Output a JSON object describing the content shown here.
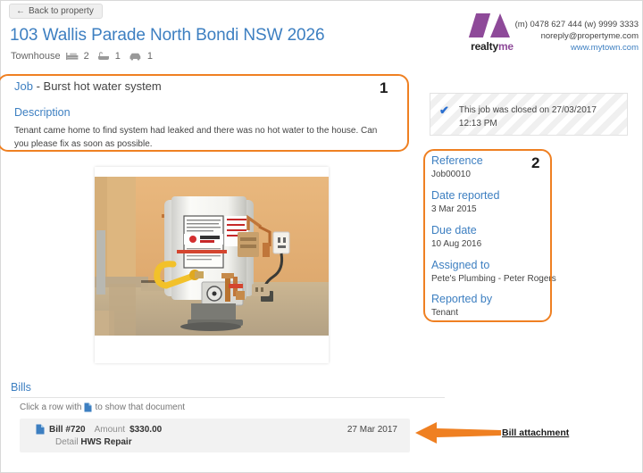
{
  "nav": {
    "back_label": "Back to property",
    "back_icon": "arrow-left-icon"
  },
  "header": {
    "address": "103 Wallis Parade North Bondi NSW 2026",
    "property_type": "Townhouse",
    "features": [
      {
        "icon": "bed-icon",
        "count": "2"
      },
      {
        "icon": "bath-icon",
        "count": "1"
      },
      {
        "icon": "car-icon",
        "count": "1"
      }
    ]
  },
  "brand": {
    "logo_icon": "realtyme-logo-icon",
    "name_first": "realty",
    "name_second": "me",
    "accent_color": "#8e4a99",
    "contact_phone": "(m) 0478 627 444 (w) 9999 3333",
    "contact_email": "noreply@propertyme.com",
    "contact_website": "www.mytown.com"
  },
  "job": {
    "label": "Job",
    "separator": " - ",
    "title": "Burst hot water system",
    "description_heading": "Description",
    "description_body": "Tenant came home to find system had leaked and there was no hot water to the house. Can you please fix as soon as possible.",
    "photo_icon": "hot-water-system-photo"
  },
  "status": {
    "check_icon": "checkmark-icon",
    "message": "This job was closed on 27/03/2017 12:13 PM"
  },
  "details": {
    "fields": [
      {
        "label": "Reference",
        "value": "Job00010"
      },
      {
        "label": "Date reported",
        "value": "3 Mar 2015"
      },
      {
        "label": "Due date",
        "value": "10 Aug 2016"
      },
      {
        "label": "Assigned to",
        "value": "Pete's Plumbing - Peter Rogers"
      },
      {
        "label": "Reported by",
        "value": "Tenant"
      }
    ]
  },
  "bills": {
    "heading": "Bills",
    "hint_before": "Click a row with",
    "hint_icon": "document-icon",
    "hint_after": "to show that document",
    "rows": [
      {
        "doc_icon": "document-icon",
        "number": "Bill #720",
        "amount_label": "Amount",
        "amount": "$330.00",
        "detail_label": "Detail",
        "detail": "HWS Repair",
        "date": "27 Mar 2017"
      }
    ]
  },
  "annotations": {
    "callout_color": "#ef8022",
    "marker_one": "1",
    "marker_two": "2",
    "arrow_icon": "arrow-left-thick-icon",
    "arrow_label": "Bill attachment"
  }
}
